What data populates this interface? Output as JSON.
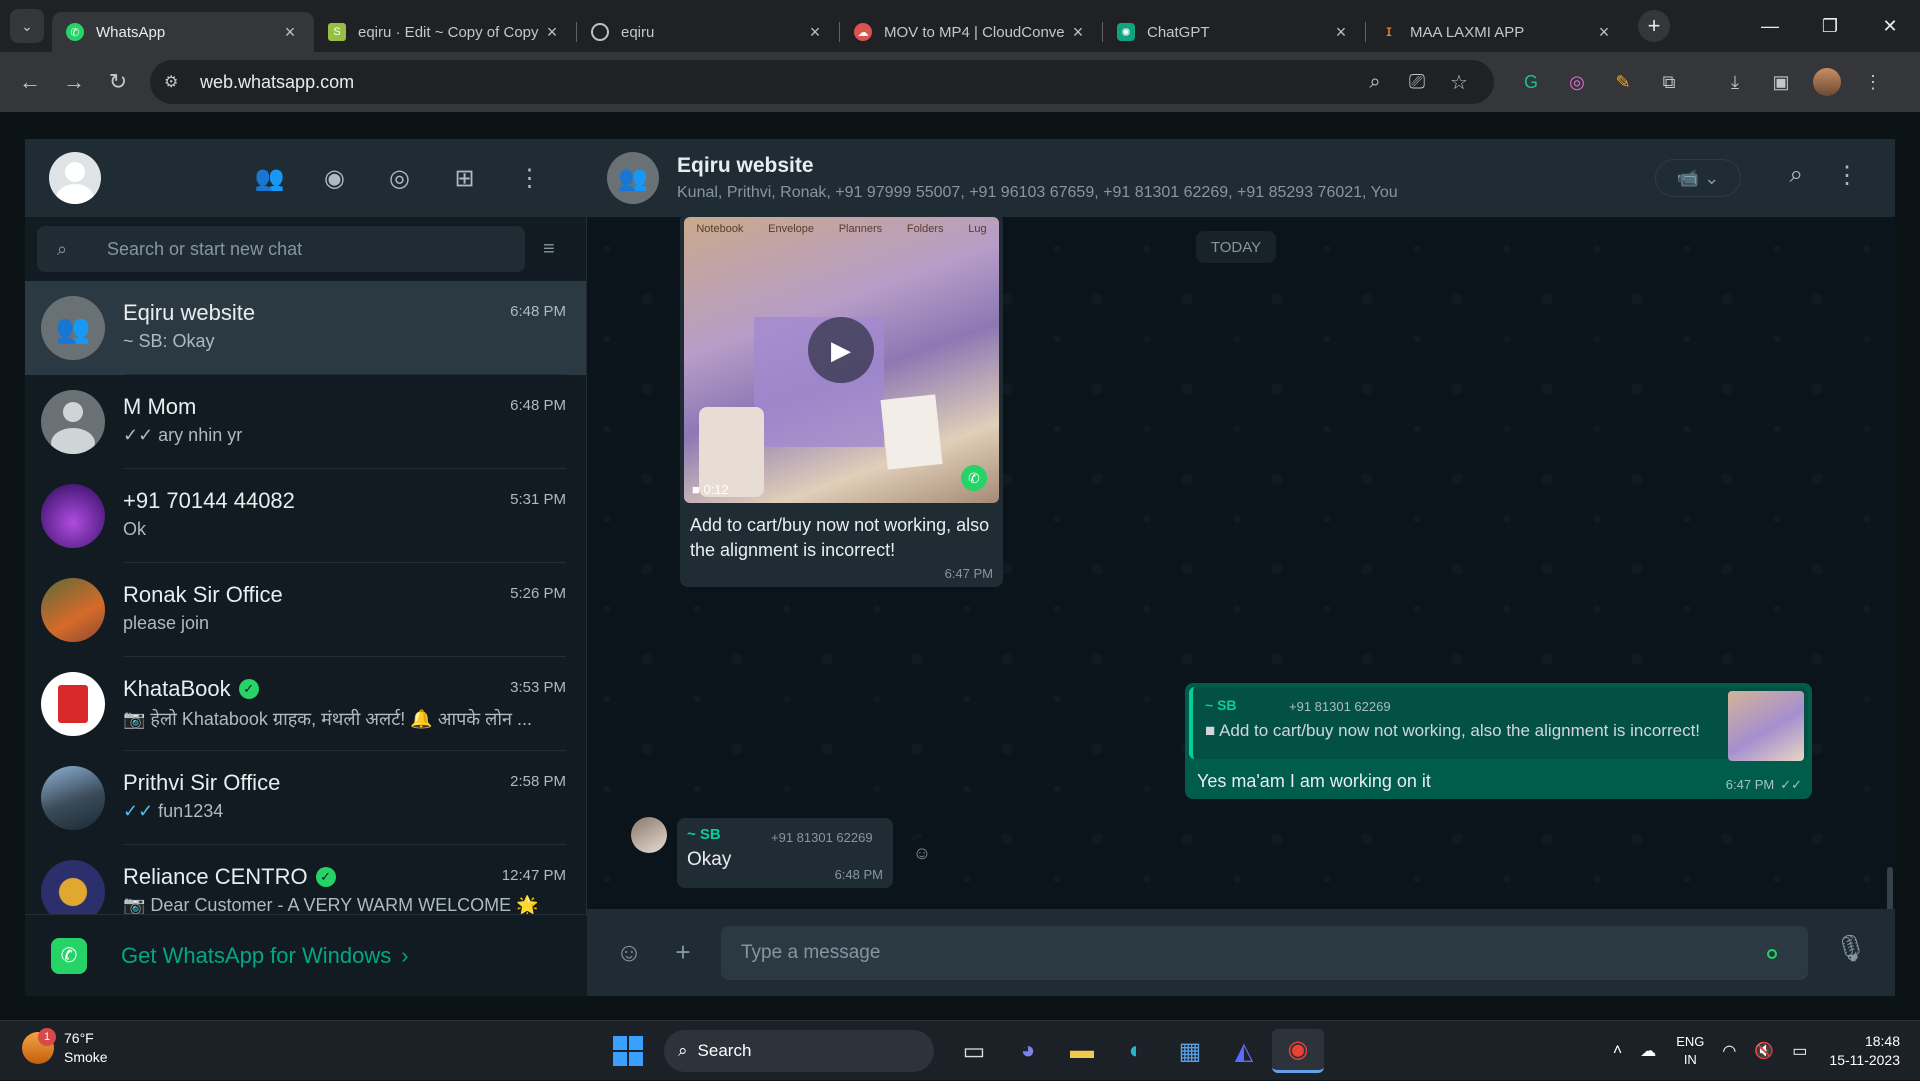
{
  "browser": {
    "tabs": [
      {
        "title": "WhatsApp",
        "favicon": "whatsapp-icon",
        "active": true
      },
      {
        "title": "eqiru · Edit ~ Copy of Copy",
        "favicon": "shopify-icon"
      },
      {
        "title": "eqiru",
        "favicon": "globe-icon"
      },
      {
        "title": "MOV to MP4 | CloudConve",
        "favicon": "cloudconvert-icon"
      },
      {
        "title": "ChatGPT",
        "favicon": "chatgpt-icon"
      },
      {
        "title": "MAA LAXMI APP",
        "favicon": "app-icon"
      }
    ],
    "url": "web.whatsapp.com"
  },
  "sidebar": {
    "search_placeholder": "Search or start new chat",
    "chats": [
      {
        "name": "Eqiru website",
        "preview": "~ SB: Okay",
        "time": "6:48 PM"
      },
      {
        "name": "M Mom",
        "preview": "ary nhin yr",
        "time": "6:48 PM"
      },
      {
        "name": "+91 70144 44082",
        "preview": "Ok",
        "time": "5:31 PM"
      },
      {
        "name": "Ronak Sir Office",
        "preview": "please join",
        "time": "5:26 PM"
      },
      {
        "name": "KhataBook",
        "preview": "हेलो Khatabook ग्राहक, मंथली अलर्ट! 🔔 आपके लोन ...",
        "time": "3:53 PM"
      },
      {
        "name": "Prithvi Sir Office",
        "preview": "fun1234",
        "time": "2:58 PM"
      },
      {
        "name": "Reliance CENTRO",
        "preview": "Dear Customer - A VERY WARM WELCOME 🌟",
        "time": "12:47 PM"
      }
    ],
    "promo": "Get WhatsApp for Windows"
  },
  "conversation": {
    "title": "Eqiru website",
    "members": "Kunal, Prithvi, Ronak, +91 97999 55007, +91 96103 67659, +91 81301 62269, +91 85293 76021, You",
    "day_label": "TODAY",
    "video_message": {
      "nav_items": [
        "Notebook",
        "Envelope",
        "Planners",
        "Folders",
        "Lug"
      ],
      "duration": "0:12",
      "caption": "Add to cart/buy now not working, also the alignment is incorrect!",
      "time": "6:47 PM"
    },
    "reply_message": {
      "quoted_sender": "~ SB",
      "quoted_phone": "+91 81301 62269",
      "quoted_text": "Add to cart/buy now not working, also the alignment is incorrect!",
      "text": "Yes ma'am I am working on it",
      "time": "6:47 PM"
    },
    "incoming_message": {
      "sender": "~ SB",
      "phone": "+91 81301 62269",
      "text": "Okay",
      "time": "6:48 PM"
    },
    "composer_placeholder": "Type a message"
  },
  "taskbar": {
    "temperature": "76°F",
    "weather": "Smoke",
    "weather_badge": "1",
    "search_label": "Search",
    "lang_primary": "ENG",
    "lang_secondary": "IN",
    "time": "18:48",
    "date": "15-11-2023"
  },
  "colors": {
    "accent": "#00a884",
    "bubble_out": "#005c4b",
    "bubble_in": "#202c33",
    "panel": "#111b21"
  }
}
